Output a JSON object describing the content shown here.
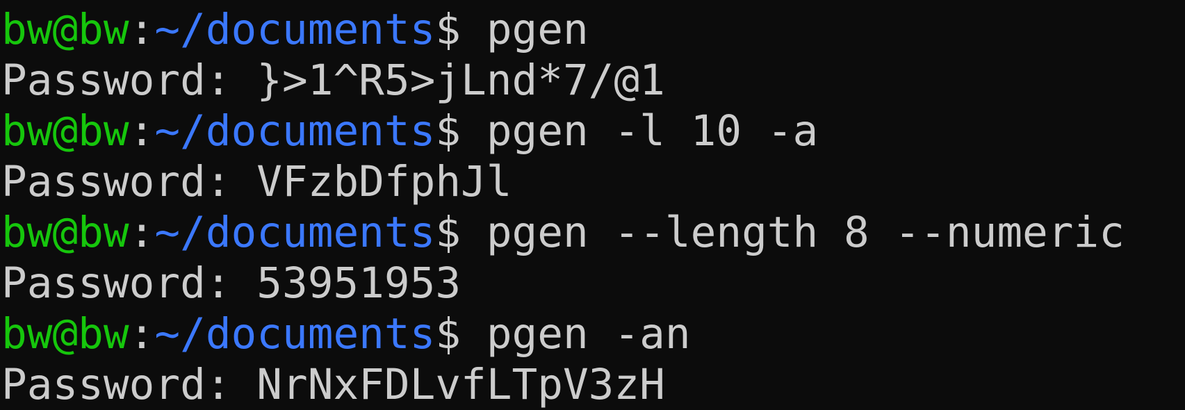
{
  "terminal": {
    "colors": {
      "background": "#0c0c0c",
      "foreground": "#cccccc",
      "user_host": "#16c60c",
      "path": "#3b78ff"
    },
    "prompt": {
      "user_host": "bw@bw",
      "colon": ":",
      "path": "~/documents",
      "symbol": "$"
    },
    "lines": [
      {
        "type": "command",
        "text": " pgen"
      },
      {
        "type": "output",
        "text": "Password: }>1^R5>jLnd*7/@1"
      },
      {
        "type": "command",
        "text": " pgen -l 10 -a"
      },
      {
        "type": "output",
        "text": "Password: VFzbDfphJl"
      },
      {
        "type": "command",
        "text": " pgen --length 8 --numeric"
      },
      {
        "type": "output",
        "text": "Password: 53951953"
      },
      {
        "type": "command",
        "text": " pgen -an"
      },
      {
        "type": "output",
        "text": "Password: NrNxFDLvfLTpV3zH"
      }
    ]
  }
}
